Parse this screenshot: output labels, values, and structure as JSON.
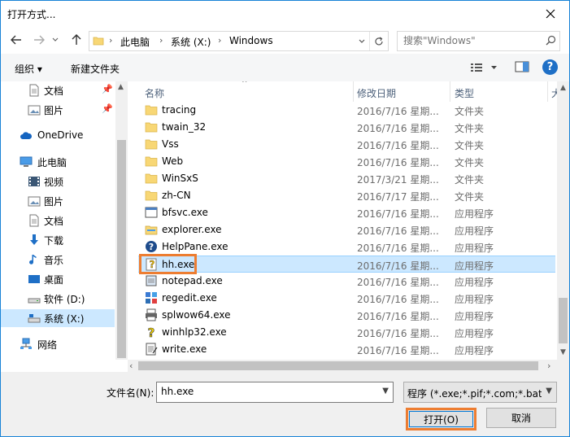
{
  "window": {
    "title": "打开方式..."
  },
  "address": {
    "segments": [
      "此电脑",
      "系统 (X:)",
      "Windows"
    ],
    "search_placeholder": "搜索\"Windows\""
  },
  "toolbar": {
    "organize_label": "组织 ▾",
    "new_folder_label": "新建文件夹",
    "help_label": "?"
  },
  "sidebar": {
    "items": [
      {
        "label": "文档",
        "icon": "document-icon",
        "pinned": true
      },
      {
        "label": "图片",
        "icon": "picture-icon",
        "pinned": true
      },
      {
        "label": "OneDrive",
        "icon": "cloud-icon",
        "pinned": false
      },
      {
        "label": "此电脑",
        "icon": "computer-icon",
        "pinned": false
      },
      {
        "label": "视频",
        "icon": "video-icon",
        "pinned": false
      },
      {
        "label": "图片",
        "icon": "picture-icon",
        "pinned": false
      },
      {
        "label": "文档",
        "icon": "document-icon",
        "pinned": false
      },
      {
        "label": "下载",
        "icon": "download-icon",
        "pinned": false
      },
      {
        "label": "音乐",
        "icon": "music-icon",
        "pinned": false
      },
      {
        "label": "桌面",
        "icon": "desktop-icon",
        "pinned": false
      },
      {
        "label": "软件 (D:)",
        "icon": "drive-icon",
        "pinned": false
      },
      {
        "label": "系统 (X:)",
        "icon": "system-drive-icon",
        "pinned": false,
        "selected": true
      },
      {
        "label": "网络",
        "icon": "network-icon",
        "pinned": false
      }
    ]
  },
  "columns": {
    "name": "名称",
    "date": "修改日期",
    "type": "类型",
    "size": "大"
  },
  "files": [
    {
      "name": "tracing",
      "date": "2016/7/16 星期...",
      "type": "文件夹",
      "icon": "folder-icon"
    },
    {
      "name": "twain_32",
      "date": "2016/7/16 星期...",
      "type": "文件夹",
      "icon": "folder-icon"
    },
    {
      "name": "Vss",
      "date": "2016/7/16 星期...",
      "type": "文件夹",
      "icon": "folder-icon"
    },
    {
      "name": "Web",
      "date": "2016/7/16 星期...",
      "type": "文件夹",
      "icon": "folder-icon"
    },
    {
      "name": "WinSxS",
      "date": "2017/3/21 星期...",
      "type": "文件夹",
      "icon": "folder-icon"
    },
    {
      "name": "zh-CN",
      "date": "2016/7/17 星期...",
      "type": "文件夹",
      "icon": "folder-icon"
    },
    {
      "name": "bfsvc.exe",
      "date": "2016/7/16 星期...",
      "type": "应用程序",
      "icon": "app-window-icon"
    },
    {
      "name": "explorer.exe",
      "date": "2016/7/16 星期...",
      "type": "应用程序",
      "icon": "explorer-icon"
    },
    {
      "name": "HelpPane.exe",
      "date": "2016/7/16 星期...",
      "type": "应用程序",
      "icon": "help-circle-icon"
    },
    {
      "name": "hh.exe",
      "date": "2016/7/16 星期...",
      "type": "应用程序",
      "icon": "help-file-icon",
      "selected": true
    },
    {
      "name": "notepad.exe",
      "date": "2016/7/16 星期...",
      "type": "应用程序",
      "icon": "notepad-icon"
    },
    {
      "name": "regedit.exe",
      "date": "2016/7/16 星期...",
      "type": "应用程序",
      "icon": "registry-icon"
    },
    {
      "name": "splwow64.exe",
      "date": "2016/7/16 星期...",
      "type": "应用程序",
      "icon": "printer-icon"
    },
    {
      "name": "winhlp32.exe",
      "date": "2016/7/16 星期...",
      "type": "应用程序",
      "icon": "help-question-icon"
    },
    {
      "name": "write.exe",
      "date": "2016/7/16 星期...",
      "type": "应用程序",
      "icon": "write-icon"
    }
  ],
  "bottom": {
    "filename_label": "文件名(N):",
    "filename_value": "hh.exe",
    "filter_value": "程序 (*.exe;*.pif;*.com;*.bat;*.",
    "open_label": "打开(O)",
    "cancel_label": "取消"
  },
  "colors": {
    "accent": "#0078d7",
    "highlight": "#ed7d31",
    "selection": "#cce8ff",
    "folder": "#f8d775"
  }
}
